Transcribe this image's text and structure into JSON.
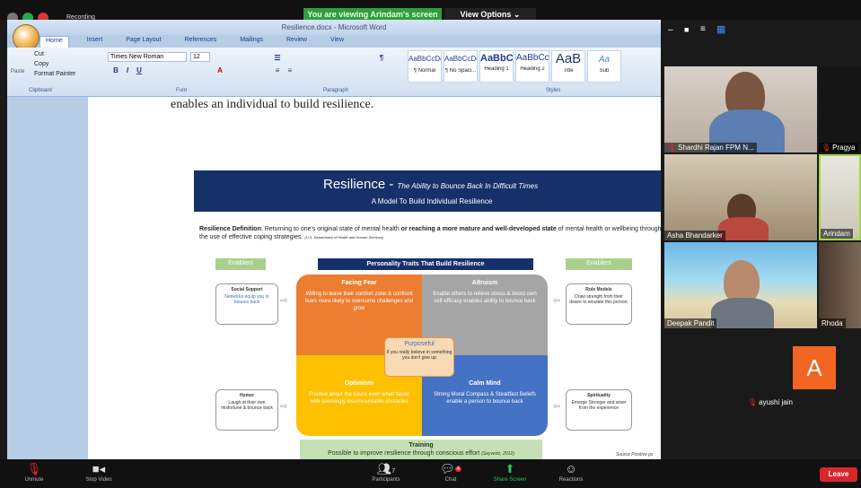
{
  "zoom_top": {
    "banner": "You are viewing Arindam's screen",
    "view_options": "View Options ⌄",
    "recording_label": "Recording",
    "view_controls": [
      "–",
      "■",
      "≡",
      "▦"
    ]
  },
  "word": {
    "window_title": "Resilience.docx - Microsoft Word",
    "tabs": [
      "Home",
      "Insert",
      "Page Layout",
      "References",
      "Mailings",
      "Review",
      "View"
    ],
    "active_tab": "Home",
    "clipboard": {
      "cut": "Cut",
      "copy": "Copy",
      "paste": "Paste",
      "format_painter": "Format Painter",
      "group": "Clipboard"
    },
    "font": {
      "name": "Times New Roman",
      "size": "12",
      "group": "Font"
    },
    "paragraph_group": "Paragraph",
    "styles_group": "Styles",
    "styles": [
      {
        "sample": "AaBbCcDc",
        "name": "¶ Normal"
      },
      {
        "sample": "AaBbCcDc",
        "name": "¶ No Spaci..."
      },
      {
        "sample": "AaBbC",
        "name": "Heading 1"
      },
      {
        "sample": "AaBbCc",
        "name": "Heading 2"
      },
      {
        "sample": "AaB",
        "name": "Title"
      },
      {
        "sample": "Aa",
        "name": "Sub"
      }
    ]
  },
  "document": {
    "line": "enables an individual to build resilience.",
    "infographic": {
      "title": "Resilience",
      "title_dash": "-",
      "tagline": "The Ability to Bounce Back In Difficult Times",
      "subtitle": "A Model To Build Individual Resilience",
      "definition_label": "Resilience Definition",
      "definition_text": ": Returning to one's original state of mental health",
      "definition_bold": " or reaching a more mature and well-developed state",
      "definition_tail": " of mental health or wellbeing through the use of effective coping strategies.",
      "definition_source": "(U.S. Department of Health and Human Services)",
      "enablers_left": "Enablers",
      "enablers_right": "Enablers",
      "traits_title": "Personality Traits That Build Resilience",
      "quadrants": [
        {
          "title": "Facing Fear",
          "text": "Willing to leave their comfort zone & confront fears more likely to overcome challenges and grow",
          "color": "#ed7d31"
        },
        {
          "title": "Altruism",
          "text": "Enable others to relieve stress & boost own self efficacy enables ability to bounce back",
          "color": "#a5a5a5"
        },
        {
          "title": "Optimism",
          "text": "Positive about the future even when faced with seemingly insurmountable obstacles",
          "color": "#ffc000"
        },
        {
          "title": "Calm Mind",
          "text": "Strong Moral Compass & Steadfast Beliefs enable a person to bounce back",
          "color": "#4472c4"
        }
      ],
      "purposeful": {
        "title": "Purposeful",
        "text": "If you really believe in something you don't give up"
      },
      "side_boxes": [
        {
          "title": "Social Support",
          "text": "Networks equip you to bounce back"
        },
        {
          "title": "Role Models",
          "text": "Draw strength from their desire to emulate this person."
        },
        {
          "title": "Humor",
          "text": "Laugh at their own misfortune & bounce back"
        },
        {
          "title": "Spirituality",
          "text": "Emerge Stronger and wiser from the experience"
        }
      ],
      "training_title": "Training",
      "training_text": "Possible to improve resilience through conscious effort",
      "training_source": "(Seyvertz, 2012)",
      "source_note": "Source Positive ps"
    }
  },
  "participants": [
    {
      "name": "Shardhi Rajan FPM N...",
      "muted": true
    },
    {
      "name": "Pragya",
      "muted": true
    },
    {
      "name": "Asha Bhandarker",
      "muted": false
    },
    {
      "name": "Arindam",
      "muted": false
    },
    {
      "name": "Deepak Pandit",
      "muted": false
    },
    {
      "name": "Rhoda",
      "muted": false
    },
    {
      "name": "ayushi jain",
      "muted": true,
      "initial": "A"
    }
  ],
  "bottom_bar": {
    "unmute": "Unmute",
    "stop_video": "Stop Video",
    "participants": "Participants",
    "participants_count": "7",
    "chat": "Chat",
    "chat_badge": "4",
    "share_screen": "Share Screen",
    "reactions": "Reactions",
    "leave": "Leave"
  },
  "colors": {
    "green_banner": "#2f9e3e",
    "header_navy": "#16306a",
    "leave_red": "#d9262a",
    "avatar_orange": "#f26522"
  }
}
